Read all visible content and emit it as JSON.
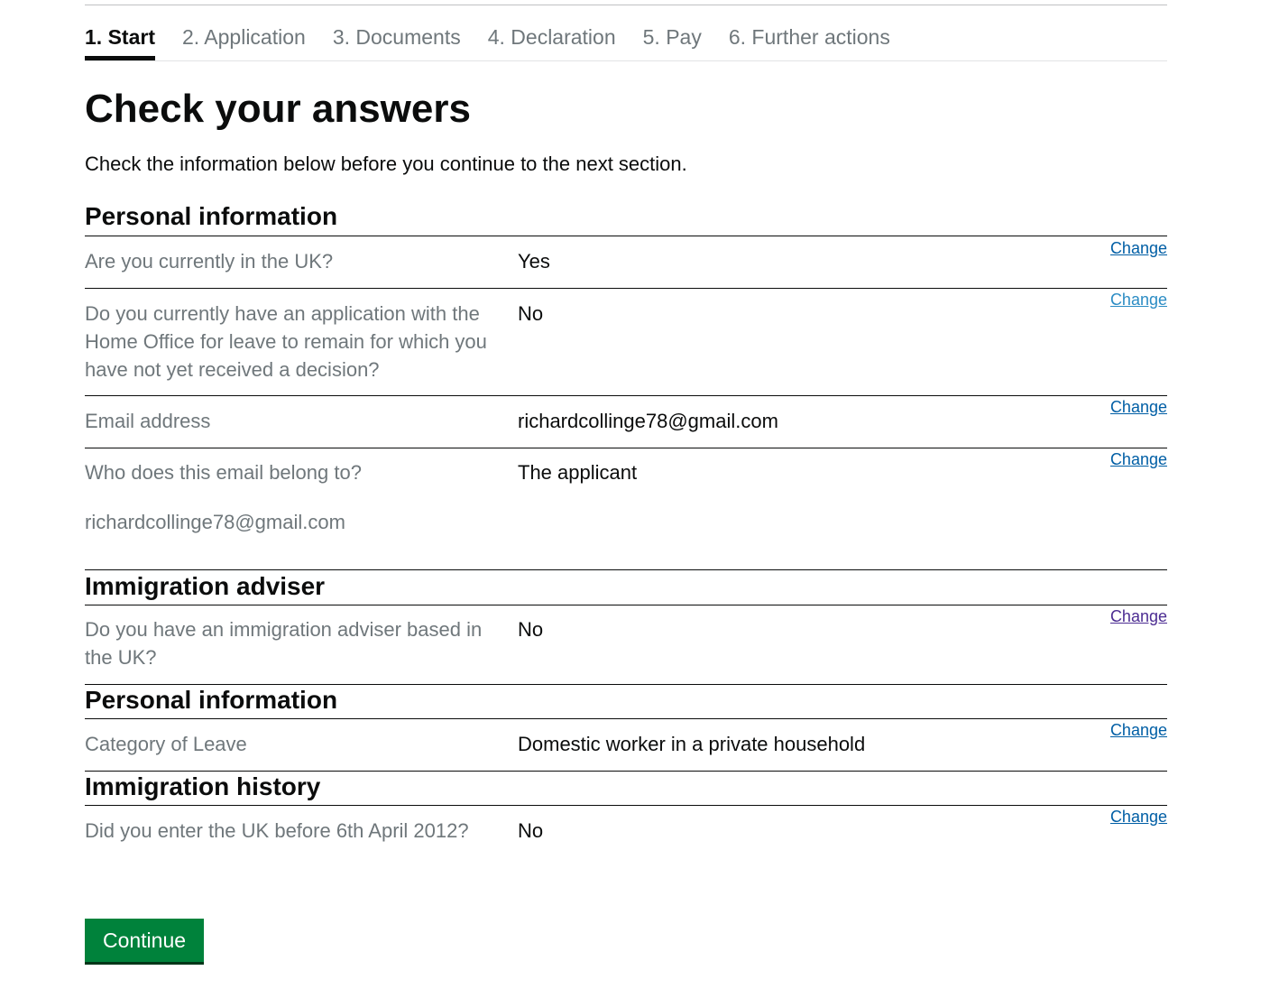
{
  "steps": [
    "1. Start",
    "2. Application",
    "3. Documents",
    "4. Declaration",
    "5. Pay",
    "6. Further actions"
  ],
  "page": {
    "title": "Check your answers",
    "lead": "Check the information below before you continue to the next section."
  },
  "sections": {
    "personal1": {
      "title": "Personal information",
      "rows": [
        {
          "q": "Are you currently in the UK?",
          "a": "Yes",
          "change": "Change"
        },
        {
          "q": "Do you currently have an application with the Home Office for leave to remain for which you have not yet received a decision?",
          "a": "No",
          "change": "Change"
        },
        {
          "q": "Email address",
          "a": "richardcollinge78@gmail.com",
          "change": "Change"
        },
        {
          "q": "Who does this email belong to?",
          "a": "The applicant",
          "change": "Change",
          "extra": "richardcollinge78@gmail.com"
        }
      ]
    },
    "adviser": {
      "title": "Immigration adviser",
      "rows": [
        {
          "q": "Do you have an immigration adviser based in the UK?",
          "a": "No",
          "change": "Change"
        }
      ]
    },
    "personal2": {
      "title": "Personal information",
      "rows": [
        {
          "q": "Category of Leave",
          "a": "Domestic worker in a private household",
          "change": "Change"
        }
      ]
    },
    "history": {
      "title": "Immigration history",
      "rows": [
        {
          "q": "Did you enter the UK before 6th April 2012?",
          "a": "No",
          "change": "Change"
        }
      ]
    }
  },
  "continue_label": "Continue",
  "colors": {
    "link": "#005ea5",
    "visited_link": "#4c2c92",
    "button": "#00823b",
    "secondary_text": "#6f777b"
  }
}
